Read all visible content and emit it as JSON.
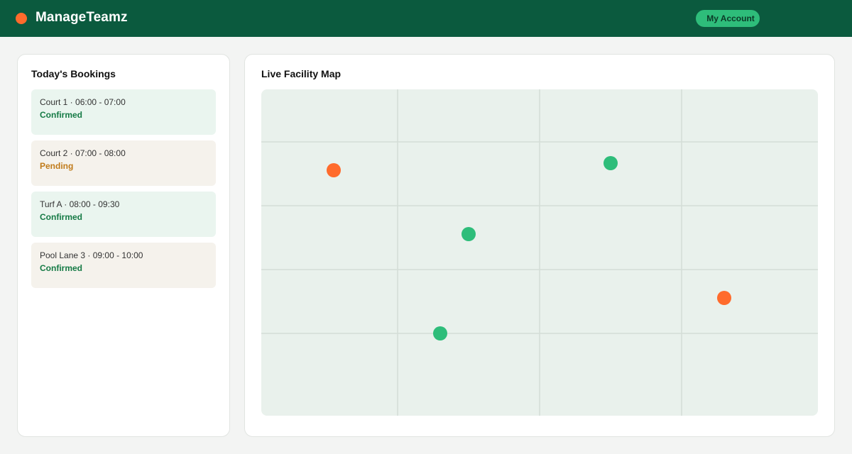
{
  "app": {
    "name": "ManageTeamz",
    "brand_color": "#ff6b2c",
    "account_label": "My Account",
    "account_color": "#2ebd7a"
  },
  "bookings": {
    "title": "Today's Bookings",
    "items": [
      {
        "line": "Court 1 · 06:00 - 07:00",
        "status": "Confirmed",
        "status_color": "#157a45",
        "tone": "ok"
      },
      {
        "line": "Court 2 · 07:00 - 08:00",
        "status": "Pending",
        "status_color": "#c07b1a",
        "tone": "pend"
      },
      {
        "line": "Turf A · 08:00 - 09:30",
        "status": "Confirmed",
        "status_color": "#157a45",
        "tone": "ok"
      },
      {
        "line": "Pool Lane 3 · 09:00 - 10:00",
        "status": "Confirmed",
        "status_color": "#157a45",
        "tone": "pend"
      }
    ]
  },
  "map": {
    "title": "Live Facility Map",
    "colors": {
      "active": "#2ebd7a",
      "alert": "#ff6b2c"
    },
    "markers": [
      {
        "kind": "alert"
      },
      {
        "kind": "active"
      },
      {
        "kind": "active"
      },
      {
        "kind": "alert"
      },
      {
        "kind": "active"
      }
    ]
  }
}
